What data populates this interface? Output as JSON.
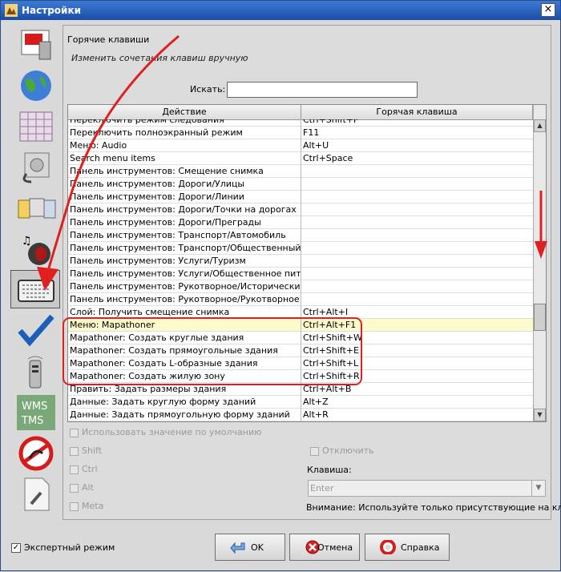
{
  "window": {
    "title": "Настройки",
    "close_label": "×"
  },
  "nav": [
    {
      "name": "paint-icon"
    },
    {
      "name": "globe-icon"
    },
    {
      "name": "grid-map-icon"
    },
    {
      "name": "power-plug-icon"
    },
    {
      "name": "folders-icon"
    },
    {
      "name": "speaker-icon"
    },
    {
      "name": "keyboard-icon"
    },
    {
      "name": "checkmark-icon"
    },
    {
      "name": "remote-control-icon"
    },
    {
      "name": "wms-tms-icon",
      "text1": "WMS",
      "text2": "TMS"
    },
    {
      "name": "no-entry-icon"
    },
    {
      "name": "document-wrench-icon"
    }
  ],
  "section": {
    "title": "Горячие клавиши",
    "subtitle": "Изменить сочетания клавиш вручную"
  },
  "search": {
    "label": "Искать:",
    "value": ""
  },
  "table": {
    "columns": [
      "Действие",
      "Горячая клавиша"
    ],
    "rows": [
      {
        "action": "Переключить режим следования",
        "key": "Ctrl+Shift+F"
      },
      {
        "action": "Переключить полноэкранный режим",
        "key": "F11"
      },
      {
        "action": "Меню: Audio",
        "key": "Alt+U"
      },
      {
        "action": "Search menu items",
        "key": "Ctrl+Space"
      },
      {
        "action": "Панель инструментов: Смещение снимка",
        "key": ""
      },
      {
        "action": "Панель инструментов: Дороги/Улицы",
        "key": ""
      },
      {
        "action": "Панель инструментов: Дороги/Линии",
        "key": ""
      },
      {
        "action": "Панель инструментов: Дороги/Точки на дорогах",
        "key": ""
      },
      {
        "action": "Панель инструментов: Дороги/Преграды",
        "key": ""
      },
      {
        "action": "Панель инструментов: Транспорт/Автомобиль",
        "key": ""
      },
      {
        "action": "Панель инструментов: Транспорт/Общественный тра...",
        "key": ""
      },
      {
        "action": "Панель инструментов: Услуги/Туризм",
        "key": ""
      },
      {
        "action": "Панель инструментов: Услуги/Общественное питание",
        "key": ""
      },
      {
        "action": "Панель инструментов: Рукотворное/Исторические ме...",
        "key": ""
      },
      {
        "action": "Панель инструментов: Рукотворное/Рукотворное",
        "key": ""
      },
      {
        "action": "Слой: Получить смещение снимка",
        "key": "Ctrl+Alt+I"
      },
      {
        "action": "Меню: Mapathoner",
        "key": "Ctrl+Alt+F1",
        "selected": true
      },
      {
        "action": "Mapathoner: Создать круглые здания",
        "key": "Ctrl+Shift+W"
      },
      {
        "action": "Mapathoner: Создать прямоугольные здания",
        "key": "Ctrl+Shift+E"
      },
      {
        "action": "Mapathoner: Создать L-образные здания",
        "key": "Ctrl+Shift+L"
      },
      {
        "action": "Mapathoner: Создать жилую зону",
        "key": "Ctrl+Shift+R"
      },
      {
        "action": "Править: Задать размеры здания",
        "key": "Ctrl+Alt+B"
      },
      {
        "action": "Данные: Задать круглую форму зданий",
        "key": "Alt+Z"
      },
      {
        "action": "Данные: Задать прямоугольную форму зданий",
        "key": "Alt+R"
      }
    ]
  },
  "options": {
    "use_default": "Использовать значение по умолчанию",
    "shift": "Shift",
    "ctrl": "Ctrl",
    "alt": "Alt",
    "meta": "Meta",
    "disable": "Отключить",
    "key_label": "Клавиша:",
    "key_value": "Enter",
    "warning": "Внимание: Используйте только присутствующие на кла..."
  },
  "footer": {
    "expert_mode": "Экспертный режим",
    "expert_checked": "✓",
    "ok": "OK",
    "cancel": "Отмена",
    "help": "Справка"
  },
  "colors": {
    "annotation": "#e02020",
    "selected_row": "#fdfacd",
    "titlebar": "#1a4ea8"
  }
}
